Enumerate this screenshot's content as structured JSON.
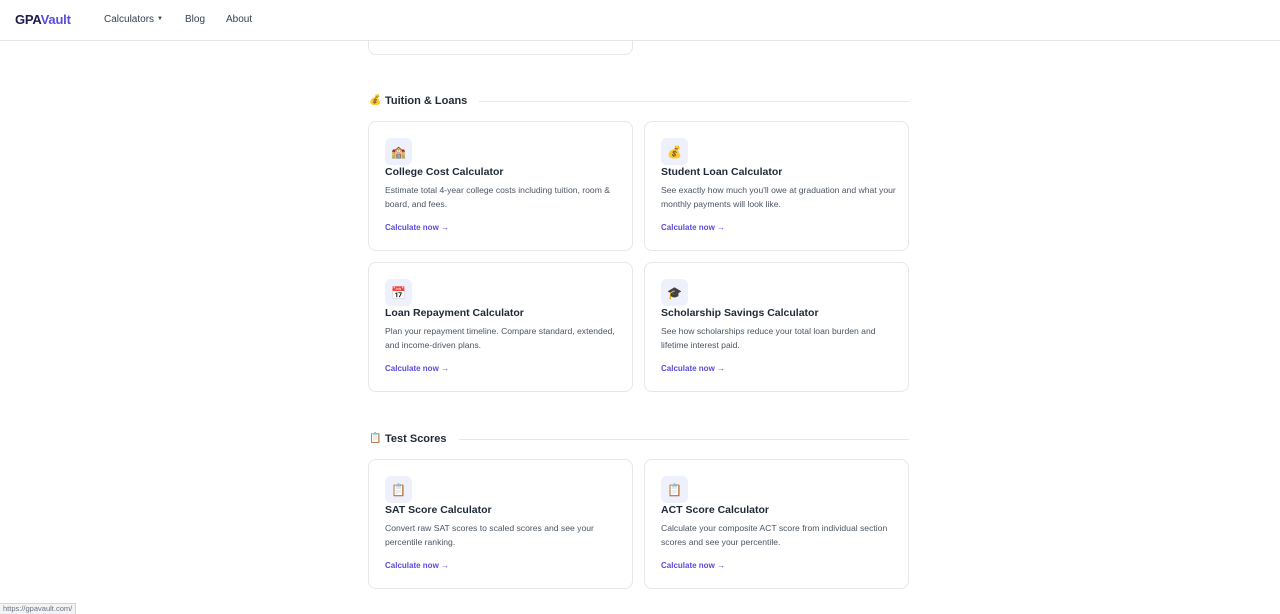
{
  "nav": {
    "brand_part1": "GPA",
    "brand_part2": "Vault",
    "calculators_label": "Calculators",
    "blog_label": "Blog",
    "about_label": "About"
  },
  "sections": [
    {
      "emoji": "💰",
      "title": "Tuition & Loans",
      "cards": [
        {
          "icon": "🏫",
          "title": "College Cost Calculator",
          "description": "Estimate total 4-year college costs including tuition, room & board, and fees.",
          "link": "Calculate now →"
        },
        {
          "icon": "💰",
          "title": "Student Loan Calculator",
          "description": "See exactly how much you'll owe at graduation and what your monthly payments will look like.",
          "link": "Calculate now →"
        },
        {
          "icon": "📅",
          "title": "Loan Repayment Calculator",
          "description": "Plan your repayment timeline. Compare standard, extended, and income-driven plans.",
          "link": "Calculate now →"
        },
        {
          "icon": "🎓",
          "title": "Scholarship Savings Calculator",
          "description": "See how scholarships reduce your total loan burden and lifetime interest paid.",
          "link": "Calculate now →"
        }
      ]
    },
    {
      "emoji": "📋",
      "title": "Test Scores",
      "cards": [
        {
          "icon": "📋",
          "title": "SAT Score Calculator",
          "description": "Convert raw SAT scores to scaled scores and see your percentile ranking.",
          "link": "Calculate now →"
        },
        {
          "icon": "📋",
          "title": "ACT Score Calculator",
          "description": "Calculate your composite ACT score from individual section scores and see your percentile.",
          "link": "Calculate now →"
        }
      ]
    }
  ],
  "status_url": "https://gpavault.com/"
}
